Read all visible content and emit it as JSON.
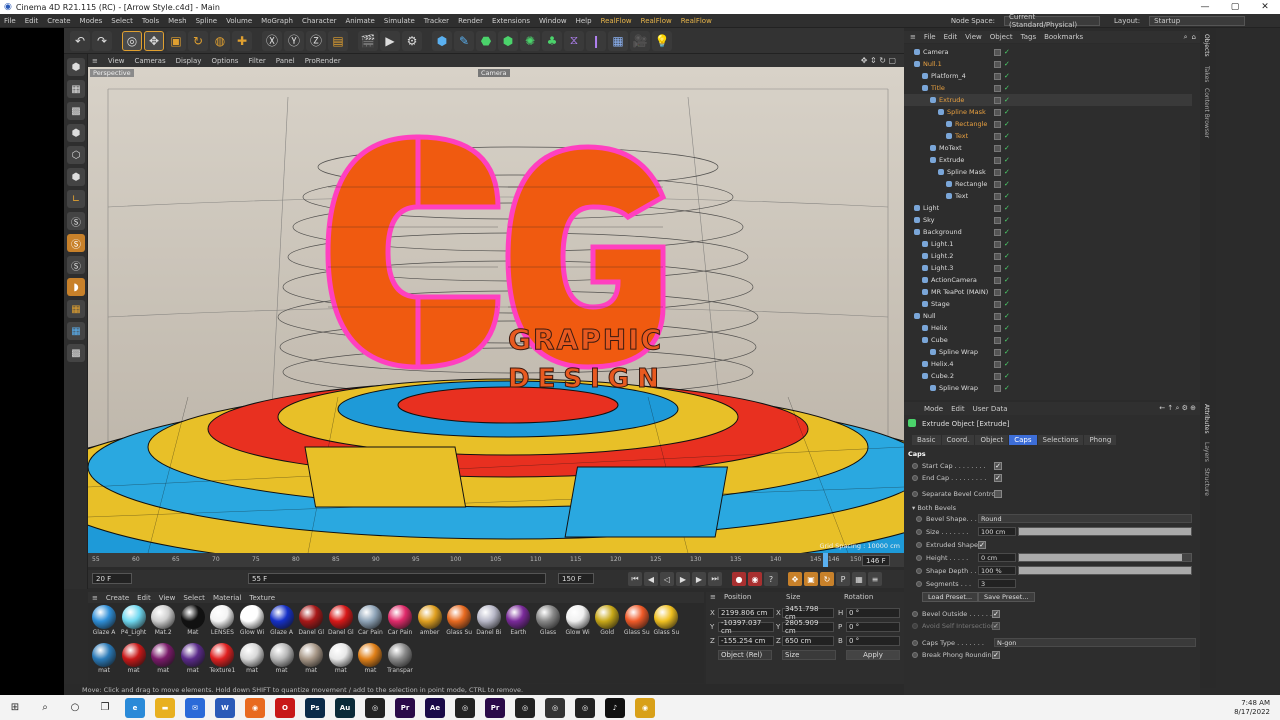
{
  "window": {
    "title": "Cinema 4D R21.115 (RC) - [Arrow Style.c4d] - Main",
    "min": "—",
    "max": "▢",
    "close": "✕"
  },
  "menubar": {
    "items": [
      "File",
      "Edit",
      "Create",
      "Modes",
      "Select",
      "Tools",
      "Mesh",
      "Spline",
      "Volume",
      "MoGraph",
      "Character",
      "Animate",
      "Simulate",
      "Tracker",
      "Render",
      "Extensions",
      "Window",
      "Help"
    ],
    "plugins": [
      "RealFlow",
      "RealFlow",
      "RealFlow"
    ],
    "node_space_label": "Node Space:",
    "node_space_value": "Current (Standard/Physical)",
    "layout_label": "Layout:",
    "layout_value": "Startup"
  },
  "viewport": {
    "menu": [
      "View",
      "Cameras",
      "Display",
      "Options",
      "Filter",
      "Panel",
      "ProRender"
    ],
    "label": "Perspective",
    "camera_tag": "Camera",
    "grid_spacing": "Grid Spacing : 10000 cm",
    "scene_text": {
      "line1": "GRAPHIC",
      "line2": "DESIGN",
      "letters": "CG"
    }
  },
  "timeline": {
    "ticks": [
      "55",
      "60",
      "65",
      "70",
      "75",
      "80",
      "85",
      "90",
      "95",
      "100",
      "105",
      "110",
      "115",
      "120",
      "125",
      "130",
      "135",
      "140",
      "145",
      "146",
      "150"
    ],
    "current_frame": "146 F",
    "start_field": "20 F",
    "current_field": "55 F",
    "end_field": "150 F",
    "end_field2": "150 F"
  },
  "materials": {
    "menu": [
      "Create",
      "Edit",
      "View",
      "Select",
      "Material",
      "Texture"
    ],
    "items": [
      {
        "label": "Glaze A",
        "color": "#2f8fd8"
      },
      {
        "label": "P4_Light",
        "color": "#6fd8f0"
      },
      {
        "label": "Mat.2",
        "color": "#cfcfcf"
      },
      {
        "label": "Mat",
        "color": "#111111"
      },
      {
        "label": "LENSES",
        "color": "#f4f4f4"
      },
      {
        "label": "Glow Wi",
        "color": "#ffffff"
      },
      {
        "label": "Glaze A",
        "color": "#1530c8"
      },
      {
        "label": "Danel Gl",
        "color": "#a81818"
      },
      {
        "label": "Danel Gl",
        "color": "#d81818"
      },
      {
        "label": "Car Pain",
        "color": "#8fa4b8"
      },
      {
        "label": "Car Pain",
        "color": "#e02a6a"
      },
      {
        "label": "amber",
        "color": "#e0a020"
      },
      {
        "label": "Glass Su",
        "color": "#e86a20"
      },
      {
        "label": "Danel Bi",
        "color": "#b8b8c8"
      },
      {
        "label": "Earth",
        "color": "#7a2a9a"
      },
      {
        "label": "Glass",
        "color": "#888888"
      },
      {
        "label": "Glow Wi",
        "color": "#f0f0f0"
      },
      {
        "label": "Gold",
        "color": "#c8a818"
      },
      {
        "label": "Glass Su",
        "color": "#f05a28"
      },
      {
        "label": "Glass Su",
        "color": "#f0c020"
      },
      {
        "label": "mat",
        "color": "#2a7ab8"
      },
      {
        "label": "mat",
        "color": "#c81818"
      },
      {
        "label": "mat",
        "color": "#7a1a6a"
      },
      {
        "label": "mat",
        "color": "#5a2a8a"
      },
      {
        "label": "Texture1",
        "color": "#e02020"
      },
      {
        "label": "mat",
        "color": "#d8d8d8"
      },
      {
        "label": "mat",
        "color": "#b8b8b8"
      },
      {
        "label": "mat",
        "color": "#a89888"
      },
      {
        "label": "mat",
        "color": "#e8e8e8"
      },
      {
        "label": "mat",
        "color": "#e08018"
      },
      {
        "label": "Transpar",
        "color": "#8a8a8a"
      }
    ]
  },
  "coords": {
    "headers": {
      "position": "Position",
      "size": "Size",
      "rotation": "Rotation"
    },
    "rows": [
      {
        "axis": "X",
        "pos": "2199.806 cm",
        "size": "3451.798 cm",
        "raxis": "H",
        "rot": "0 °"
      },
      {
        "axis": "Y",
        "pos": "-10397.037 cm",
        "size": "2805.909 cm",
        "raxis": "P",
        "rot": "0 °"
      },
      {
        "axis": "Z",
        "pos": "-155.254 cm",
        "size": "650 cm",
        "raxis": "B",
        "rot": "0 °"
      }
    ],
    "mode": "Object (Rel)",
    "size_mode": "Size",
    "apply": "Apply"
  },
  "status": "Move: Click and drag to move elements. Hold down SHIFT to quantize movement / add to the selection in point mode, CTRL to remove.",
  "objects": {
    "menu": [
      "File",
      "Edit",
      "View",
      "Object",
      "Tags",
      "Bookmarks"
    ],
    "rows": [
      {
        "name": "Camera",
        "indent": 0,
        "hl": false
      },
      {
        "name": "Null.1",
        "indent": 0,
        "hl": true
      },
      {
        "name": "Platform_4",
        "indent": 1,
        "hl": false
      },
      {
        "name": "Title",
        "indent": 1,
        "hl": true
      },
      {
        "name": "Extrude",
        "indent": 2,
        "hl": true
      },
      {
        "name": "Spline Mask",
        "indent": 3,
        "hl": true
      },
      {
        "name": "Rectangle",
        "indent": 4,
        "hl": true
      },
      {
        "name": "Text",
        "indent": 4,
        "hl": true
      },
      {
        "name": "MoText",
        "indent": 2,
        "hl": false
      },
      {
        "name": "Extrude",
        "indent": 2,
        "hl": false
      },
      {
        "name": "Spline Mask",
        "indent": 3,
        "hl": false
      },
      {
        "name": "Rectangle",
        "indent": 4,
        "hl": false
      },
      {
        "name": "Text",
        "indent": 4,
        "hl": false
      },
      {
        "name": "Light",
        "indent": 0,
        "hl": false
      },
      {
        "name": "Sky",
        "indent": 0,
        "hl": false
      },
      {
        "name": "Background",
        "indent": 0,
        "hl": false
      },
      {
        "name": "Light.1",
        "indent": 1,
        "hl": false
      },
      {
        "name": "Light.2",
        "indent": 1,
        "hl": false
      },
      {
        "name": "Light.3",
        "indent": 1,
        "hl": false
      },
      {
        "name": "ActionCamera",
        "indent": 1,
        "hl": false
      },
      {
        "name": "MR TeaPot (MAIN)",
        "indent": 1,
        "hl": false
      },
      {
        "name": "Stage",
        "indent": 1,
        "hl": false
      },
      {
        "name": "Null",
        "indent": 0,
        "hl": false
      },
      {
        "name": "Helix",
        "indent": 1,
        "hl": false
      },
      {
        "name": "Cube",
        "indent": 1,
        "hl": false
      },
      {
        "name": "Spline Wrap",
        "indent": 2,
        "hl": false
      },
      {
        "name": "Helix.4",
        "indent": 1,
        "hl": false
      },
      {
        "name": "Cube.2",
        "indent": 1,
        "hl": false
      },
      {
        "name": "Spline Wrap",
        "indent": 2,
        "hl": false
      }
    ]
  },
  "side_tabs": {
    "objects": "Objects",
    "takes": "Takes",
    "content": "Content Browser",
    "attributes": "Attributes",
    "layers": "Layers",
    "structure": "Structure"
  },
  "attributes": {
    "menu": [
      "Mode",
      "Edit",
      "User Data"
    ],
    "title": "Extrude Object [Extrude]",
    "tabs": [
      "Basic",
      "Coord.",
      "Object",
      "Caps",
      "Selections",
      "Phong"
    ],
    "active_tab": "Caps",
    "section": "Caps",
    "start_cap": "Start Cap . . . . . . . .",
    "end_cap": "End Cap . . . . . . . . .",
    "separate_bevel": "Separate Bevel Controls",
    "both_bevels": "Both Bevels",
    "bevel_shape_label": "Bevel Shape. . .",
    "bevel_shape_value": "Round",
    "size_label": "Size . . . . . . .",
    "size_value": "100 cm",
    "extruded_shape": "Extruded Shape",
    "height_label": "Height . . . . .",
    "height_value": "0 cm",
    "height_fill": 0.95,
    "shape_depth_label": "Shape Depth . .",
    "shape_depth_value": "100 %",
    "shape_depth_fill": 1.0,
    "segments_label": "Segments . . .",
    "segments_value": "3",
    "load_preset": "Load Preset...",
    "save_preset": "Save Preset...",
    "bevel_outside": "Bevel Outside . . . . . .",
    "avoid_self": "Avoid Self Intersections",
    "caps_type_label": "Caps Type . . . . . . .",
    "caps_type_value": "N-gon",
    "break_phong": "Break Phong Rounding"
  },
  "taskbar": {
    "apps": [
      {
        "name": "start",
        "glyph": "⊞",
        "color": ""
      },
      {
        "name": "search",
        "glyph": "⌕",
        "color": ""
      },
      {
        "name": "cortana",
        "glyph": "○",
        "color": ""
      },
      {
        "name": "taskview",
        "glyph": "❐",
        "color": ""
      },
      {
        "name": "edge",
        "glyph": "e",
        "color": "#2a8ad8"
      },
      {
        "name": "explorer",
        "glyph": "▬",
        "color": "#e8b020"
      },
      {
        "name": "mail",
        "glyph": "✉",
        "color": "#2a6ad8"
      },
      {
        "name": "word",
        "glyph": "W",
        "color": "#2a5ab8"
      },
      {
        "name": "firefox",
        "glyph": "◉",
        "color": "#e86a20"
      },
      {
        "name": "opera",
        "glyph": "O",
        "color": "#c81818"
      },
      {
        "name": "photoshop",
        "glyph": "Ps",
        "color": "#0a2a48"
      },
      {
        "name": "audition",
        "glyph": "Au",
        "color": "#0a2a38"
      },
      {
        "name": "c4d",
        "glyph": "◎",
        "color": "#222"
      },
      {
        "name": "premiere",
        "glyph": "Pr",
        "color": "#2a0a48"
      },
      {
        "name": "aftereffects",
        "glyph": "Ae",
        "color": "#1a0a48"
      },
      {
        "name": "c4d2",
        "glyph": "◎",
        "color": "#222"
      },
      {
        "name": "premiere2",
        "glyph": "Pr",
        "color": "#2a0a48"
      },
      {
        "name": "c4d3",
        "glyph": "◎",
        "color": "#222"
      },
      {
        "name": "c4d4",
        "glyph": "◎",
        "color": "#333"
      },
      {
        "name": "c4d5",
        "glyph": "◎",
        "color": "#222"
      },
      {
        "name": "tiktok",
        "glyph": "♪",
        "color": "#111"
      },
      {
        "name": "chrome",
        "glyph": "◉",
        "color": "#d8a018"
      }
    ],
    "time": "7:48 AM",
    "date": "8/17/2022"
  }
}
